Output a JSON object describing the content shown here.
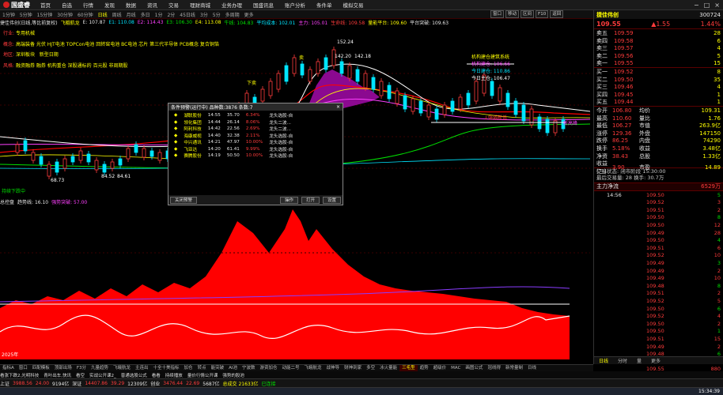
{
  "app": {
    "logo_text": "国盛睿",
    "menu": [
      "首页",
      "自选",
      "行情",
      "发现",
      "数据",
      "资讯",
      "交易",
      "理财商城",
      "业务办理",
      "国盛讯息",
      "账户分析",
      "条件单",
      "模拟交易"
    ],
    "window_buttons": [
      "−",
      "□",
      "×"
    ]
  },
  "periodbar": {
    "items": [
      "1分钟",
      "5分钟",
      "15分钟",
      "30分钟",
      "60分钟",
      "日线",
      "周线",
      "月线",
      "多日",
      "1分",
      "2分",
      "45日线",
      "3分",
      "5分",
      "多周期",
      "更多"
    ],
    "active_index": 5
  },
  "rightbuttons": [
    "窗口",
    "移动",
    "区间",
    "F10",
    "返回"
  ],
  "infoline": {
    "fields": [
      {
        "text": "捷佳伟创(日线,等比前复权)",
        "color": "white"
      },
      {
        "text": "飞蛾航龙 ",
        "color": "yellow"
      },
      {
        "text": "E: 107.87",
        "color": "white"
      },
      {
        "text": "E1: 110.08",
        "color": "cyan"
      },
      {
        "text": "E2: 114.43",
        "color": "magenta"
      },
      {
        "text": "E3: 106.30",
        "color": "green"
      },
      {
        "text": "E4: 113.08",
        "color": "yellow"
      },
      {
        "text": "牛线: 104.83",
        "color": "green"
      },
      {
        "text": "平均成本: 102.01",
        "color": "cyan"
      },
      {
        "text": "主力: 105.01",
        "color": "magenta"
      },
      {
        "text": "生命线: 109.58",
        "color": "red"
      },
      {
        "text": "量能平台: 109.60",
        "color": "yellow"
      },
      {
        "text": "平台突破: 109.63",
        "color": "white"
      }
    ]
  },
  "tags": [
    {
      "label": "行业:",
      "value": "专用机械"
    },
    {
      "label": "概念:",
      "value": "高端装备 光伏 HJT电池 TOPCon电池 回转窑电池 BC电池 芯片 第三代半导体 PCB概念 复合铜箔"
    },
    {
      "label": "地区:",
      "value": "深圳板块",
      "extra": "新型日期"
    },
    {
      "label": "风格:",
      "value": "融资融券 融券 机构重仓 深股通标的 百元股 非周期股"
    }
  ],
  "annotations": {
    "high_label": "152.24",
    "mid1": "142.20",
    "mid2": "142.18",
    "low1": "68.73",
    "low2": "84.52",
    "low3": "84.61",
    "cost_label": "机构建仓建筑系统",
    "cost_rows": [
      "机构建仓: 106.66",
      "今日建仓: 110.86",
      "今日主仓: 106.47"
    ],
    "down_label": "下卖",
    "sell_label": "卖",
    "buy_tag": "↓强弱新低",
    "br_label": "新高峰",
    "bot_label": "持续下跌中",
    "year_label": "2025年"
  },
  "popup": {
    "title": "条件预警(运行中) 品种数:3876 条数:7",
    "rows": [
      [
        "湖联股份",
        "14:55",
        "35.70",
        "6.34%",
        "龙头选股-自"
      ],
      [
        "领化集团",
        "14:44",
        "26.14",
        "8.06%",
        "龙头二波..."
      ],
      [
        "阿利科技",
        "14:42",
        "22.56",
        "2.69%",
        "龙头二波..."
      ],
      [
        "海康威视",
        "14:40",
        "32.38",
        "2.11%",
        "龙头选股-自"
      ],
      [
        "中兴通讯",
        "14:21",
        "47.97",
        "10.00%",
        "龙头选股-自"
      ],
      [
        "飞亚达",
        "14:20",
        "61.41",
        "9.99%",
        "龙头选股-自"
      ],
      [
        "赛腾股份",
        "14:19",
        "50.50",
        "10.00%",
        "龙头选股-自"
      ]
    ],
    "close_btn": "关闭预警",
    "op_btn": "操作",
    "open_btn": "打开",
    "set_btn": "设置"
  },
  "subhead": {
    "name": "总控盘",
    "fields": [
      {
        "text": "趋势线: 16.10",
        "color": "white"
      },
      {
        "text": "强势突破: 57.00",
        "color": "magenta"
      }
    ]
  },
  "rpanel": {
    "name": "捷佳伟创",
    "code": "300724",
    "price": "109.55",
    "change": "1.55",
    "pct": "1.44%",
    "asks": [
      [
        "卖五",
        "109.59",
        "28"
      ],
      [
        "卖四",
        "109.58",
        "6"
      ],
      [
        "卖三",
        "109.57",
        "4"
      ],
      [
        "卖二",
        "109.56",
        "5"
      ],
      [
        "卖一",
        "109.55",
        "15"
      ]
    ],
    "bids": [
      [
        "买一",
        "109.52",
        "8"
      ],
      [
        "买二",
        "109.50",
        "35"
      ],
      [
        "买三",
        "109.46",
        "4"
      ],
      [
        "买四",
        "109.45",
        "1"
      ],
      [
        "买五",
        "109.44",
        "1"
      ]
    ],
    "stats": [
      [
        "今开",
        "106.80",
        "均价",
        "109.31"
      ],
      [
        "最高",
        "110.60",
        "量比",
        "1.76"
      ],
      [
        "最低",
        "106.27",
        "市值",
        "263.9亿"
      ],
      [
        "涨停",
        "129.36",
        "外盘",
        "147150"
      ],
      [
        "跌停",
        "86.25",
        "内盘",
        "74290"
      ],
      [
        "换手",
        "5.18%",
        "收益",
        "3.48亿"
      ],
      [
        "净资",
        "38.43",
        "总股",
        "1.33亿"
      ],
      [
        "收益(三)",
        "3.90",
        "市盈",
        "14.89"
      ]
    ],
    "status_line": "交易状态: 闭市阶段 15:30:00",
    "last_trade": "最后交易量: 28   换手: 30.7万",
    "net_inflow_label": "主力净流",
    "net_inflow_value": "6529万",
    "ticks": [
      [
        "14:56",
        "109.50",
        "5"
      ],
      [
        "",
        "109.52",
        "3"
      ],
      [
        "",
        "109.51",
        "2"
      ],
      [
        "",
        "109.50",
        "8"
      ],
      [
        "",
        "109.50",
        "12"
      ],
      [
        "",
        "109.49",
        "28"
      ],
      [
        "",
        "109.50",
        "4"
      ],
      [
        "",
        "109.51",
        "6"
      ],
      [
        "",
        "109.52",
        "10"
      ],
      [
        "",
        "109.49",
        "3"
      ],
      [
        "",
        "109.49",
        "2"
      ],
      [
        "",
        "109.49",
        "10"
      ],
      [
        "",
        "109.48",
        "8"
      ],
      [
        "",
        "109.51",
        "2"
      ],
      [
        "",
        "109.52",
        "5"
      ],
      [
        "",
        "109.50",
        "6"
      ],
      [
        "",
        "109.52",
        "4"
      ],
      [
        "",
        "109.50",
        "2"
      ],
      [
        "",
        "109.50",
        "1"
      ],
      [
        "",
        "109.51",
        "15"
      ],
      [
        "",
        "109.49",
        "2"
      ],
      [
        "",
        "109.48",
        "6"
      ],
      [
        "",
        "109.50",
        "2"
      ],
      [
        "",
        "109.55",
        "880"
      ]
    ],
    "bottom_tabs": [
      "日线",
      "分时",
      "量",
      "更多"
    ]
  },
  "tabbar": {
    "items": [
      "指标A",
      "窗口",
      "匹配模板",
      "顶部出场",
      "F3分",
      "九量趋势",
      "飞蛾航龙",
      "主连出",
      "十全十美指标",
      "加仓",
      "转点",
      "能突破",
      "AI池",
      "宁波数",
      "游资加仓",
      "动能二号",
      "飞蛾航龙",
      "战神导",
      "财神到家",
      "多空",
      "冰火量能",
      "三毛型",
      "趋势",
      "超级价",
      "MAC",
      "画图公式",
      "冠线得",
      "新常量制",
      "日线"
    ],
    "active_index": 21
  },
  "newsbar": [
    "看涨下跌2,光明科技",
    "青叶出车,快讯",
    "看空",
    "实战公开课2_",
    "普通选股公式",
    "看看",
    "持续播放",
    "量价行情公开课",
    "强势的股池"
  ],
  "footer": [
    {
      "text": "上证",
      "color": "white"
    },
    {
      "text": "3988.56",
      "color": "red"
    },
    {
      "text": "24.00",
      "color": "red"
    },
    {
      "text": "9194亿",
      "color": "white"
    },
    {
      "text": "深证",
      "color": "white"
    },
    {
      "text": "14407.86",
      "color": "red"
    },
    {
      "text": "39.29",
      "color": "red"
    },
    {
      "text": "12309亿",
      "color": "white"
    },
    {
      "text": "创业",
      "color": "white"
    },
    {
      "text": "3476.44",
      "color": "red"
    },
    {
      "text": "22.69",
      "color": "red"
    },
    {
      "text": "5687亿",
      "color": "white"
    },
    {
      "text": "总成交 21633亿",
      "color": "yellow"
    },
    {
      "text": "已连接",
      "color": "green"
    }
  ],
  "taskbar": {
    "time": "15:34:39"
  },
  "colors": {
    "up": "#ff3b3b",
    "down": "#00e000",
    "accent": "#ffff00",
    "fill": "#ff0000"
  }
}
